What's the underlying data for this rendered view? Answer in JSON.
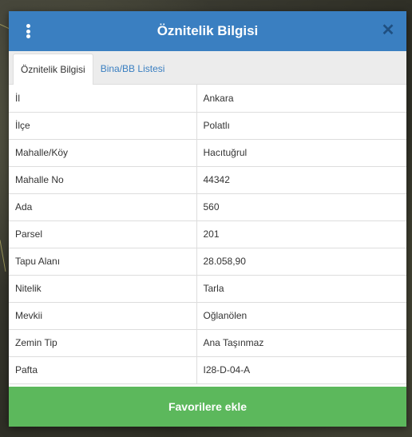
{
  "header": {
    "title": "Öznitelik Bilgisi"
  },
  "tabs": [
    {
      "label": "Öznitelik Bilgisi",
      "active": true
    },
    {
      "label": "Bina/BB Listesi",
      "active": false
    }
  ],
  "attributes": [
    {
      "key": "İl",
      "value": "Ankara"
    },
    {
      "key": "İlçe",
      "value": "Polatlı"
    },
    {
      "key": "Mahalle/Köy",
      "value": "Hacıtuğrul"
    },
    {
      "key": "Mahalle No",
      "value": "44342"
    },
    {
      "key": "Ada",
      "value": "560"
    },
    {
      "key": "Parsel",
      "value": "201"
    },
    {
      "key": "Tapu Alanı",
      "value": "28.058,90"
    },
    {
      "key": "Nitelik",
      "value": "Tarla"
    },
    {
      "key": "Mevkii",
      "value": "Oğlanölen"
    },
    {
      "key": "Zemin Tip",
      "value": "Ana Taşınmaz"
    },
    {
      "key": "Pafta",
      "value": "I28-D-04-A"
    }
  ],
  "footer": {
    "button_label": "Favorilere ekle"
  },
  "colors": {
    "header": "#3a7fc1",
    "button": "#5cb85c"
  }
}
